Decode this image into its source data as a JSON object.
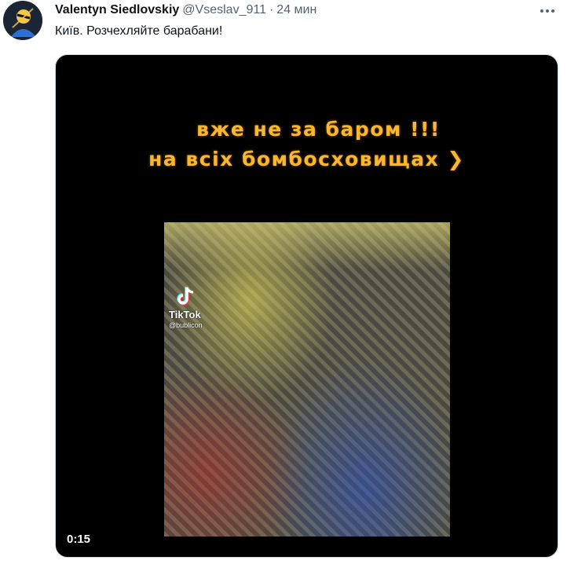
{
  "tweet": {
    "author_name": "Valentyn Siedlovskiy",
    "handle": "@Vseslav_911",
    "separator": "·",
    "time": "24 мин",
    "text": "Київ. Розчехляйте барабани!"
  },
  "video": {
    "overlay_line1": "вже не за баром !!!",
    "overlay_line2": "на всіх бомбосховищах ❯",
    "watermark_brand": "TikTok",
    "watermark_user": "@bublicon",
    "duration": "0:15"
  },
  "icons": {
    "more": "more-horizontal-icon",
    "tiktok": "tiktok-logo-icon"
  },
  "colors": {
    "overlay_text": "#f7b733",
    "secondary_text": "#536471"
  }
}
